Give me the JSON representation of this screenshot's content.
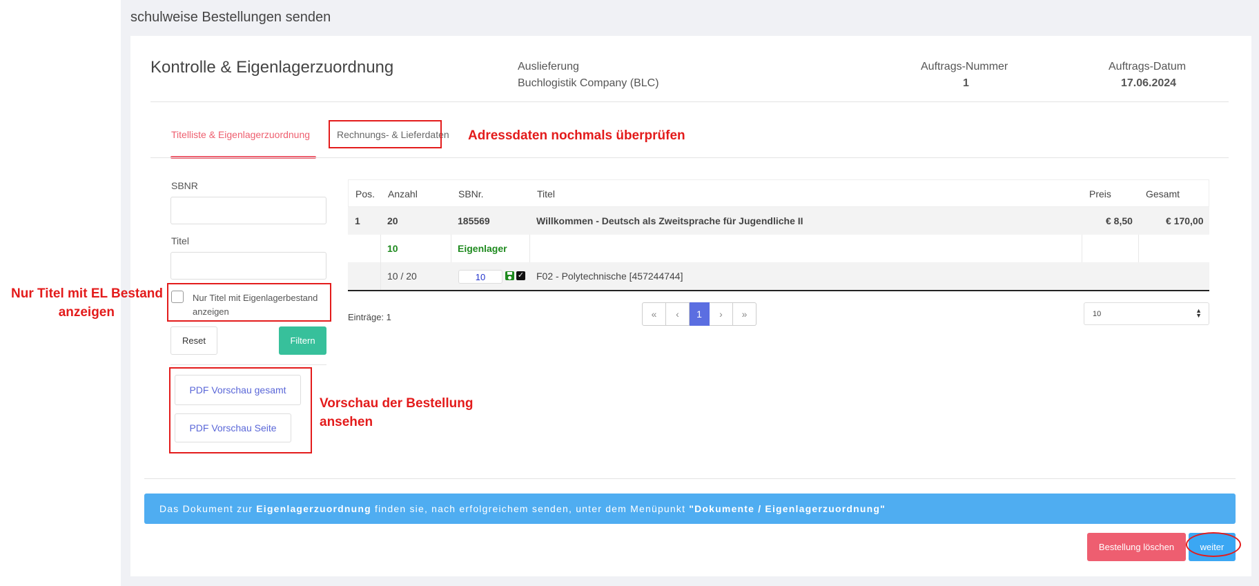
{
  "page": {
    "title": "schulweise Bestellungen senden"
  },
  "header": {
    "title": "Kontrolle & Eigenlagerzuordnung",
    "delivery_label": "Auslieferung",
    "delivery_value": "Buchlogistik Company (BLC)",
    "order_number_label": "Auftrags-Nummer",
    "order_number_value": "1",
    "order_date_label": "Auftrags-Datum",
    "order_date_value": "17.06.2024"
  },
  "tabs": [
    {
      "label": "Titelliste & Eigenlagerzuordnung",
      "active": true
    },
    {
      "label": "Rechnungs- & Lieferdaten",
      "active": false
    }
  ],
  "filters": {
    "sbnr_label": "SBNR",
    "sbnr_value": "",
    "titel_label": "Titel",
    "titel_value": "",
    "checkbox_label_line1": "Nur Titel mit Eigenlagerbestand",
    "checkbox_label_line2": "anzeigen",
    "checkbox_checked": false,
    "reset_label": "Reset",
    "filter_label": "Filtern"
  },
  "pdf": {
    "gesamt_label": "PDF Vorschau gesamt",
    "seite_label": "PDF Vorschau Seite"
  },
  "table": {
    "columns": [
      "Pos.",
      "Anzahl",
      "SBNr.",
      "Titel",
      "Preis",
      "Gesamt"
    ],
    "row1": {
      "pos": "1",
      "anzahl": "20",
      "sbnr": "185569",
      "titel": "Willkommen - Deutsch als Zweitsprache für Jugendliche II",
      "preis": "€ 8,50",
      "gesamt": "€ 170,00"
    },
    "row2": {
      "anzahl": "10",
      "sbnr": "Eigenlager"
    },
    "row3": {
      "anzahl": "10 / 20",
      "qty_input": "10",
      "titel": "F02 - Polytechnische [457244744]"
    }
  },
  "pagination": {
    "entries_text": "Einträge: 1",
    "first": "«",
    "prev": "‹",
    "current": "1",
    "next": "›",
    "last": "»",
    "page_size": "10"
  },
  "banner": {
    "part1": "Das Dokument zur ",
    "bold1": "Eigenlagerzuordnung",
    "part2": " finden sie, nach erfolgreichem senden, unter dem Menüpunkt ",
    "bold2": "\"Dokumente / Eigenlagerzuordnung\""
  },
  "actions": {
    "delete_label": "Bestellung löschen",
    "next_label": "weiter"
  },
  "annotations": {
    "address": "Adressdaten nochmals überprüfen",
    "el_line1": "Nur Titel mit EL Bestand",
    "el_line2": "anzeigen",
    "preview_line1": "Vorschau der Bestellung",
    "preview_line2": "ansehen"
  },
  "colors": {
    "accent_red": "#ee5e6e",
    "filter_green": "#37c09b",
    "pager_active": "#5b6ee1",
    "banner_blue": "#4fadf1",
    "annotation_red": "#e31b1b",
    "eigenlager_green": "#1e8a1e"
  }
}
